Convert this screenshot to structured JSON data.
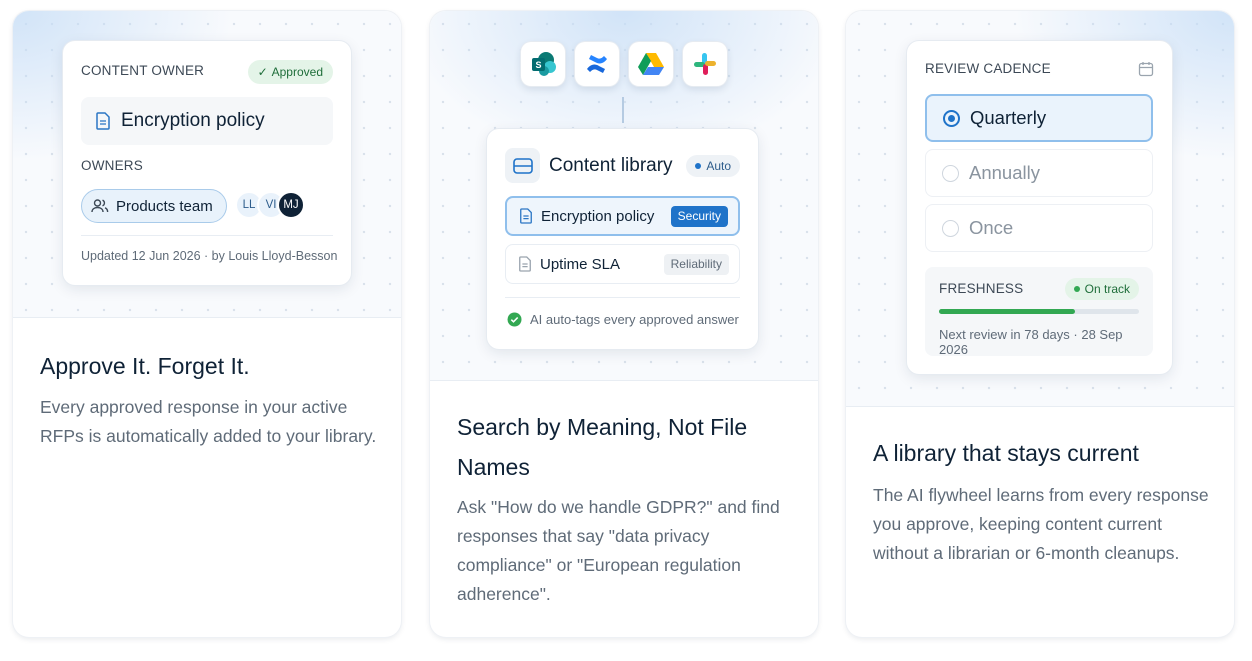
{
  "cards": [
    {
      "heading": "Approve It. Forget It.",
      "description": "Every approved response in your active RFPs is automatically added to your library.",
      "panel": {
        "label": "CONTENT OWNER",
        "status": "Approved",
        "document": "Encryption policy",
        "owners_label": "OWNERS",
        "team": "Products team",
        "avatars": [
          "LL",
          "VI",
          "MJ"
        ],
        "updated": "Updated 12 Jun 2026 · by Louis Lloyd-Besson"
      }
    },
    {
      "heading": "Search by Meaning, Not File Names",
      "description": "Ask \"How do we handle GDPR?\" and find responses that say \"data privacy compliance\" or \"European regulation adherence\".",
      "integrations": [
        "sharepoint-icon",
        "confluence-icon",
        "google-drive-icon",
        "slack-icon"
      ],
      "panel": {
        "title": "Content library",
        "mode": "Auto",
        "items": [
          {
            "name": "Encryption policy",
            "tag": "Security"
          },
          {
            "name": "Uptime SLA",
            "tag": "Reliability"
          }
        ],
        "footer": "AI auto-tags every approved answer"
      }
    },
    {
      "heading": "A library that stays current",
      "description": "The AI flywheel learns from every response you approve, keeping content current without a librarian or 6-month cleanups.",
      "panel": {
        "label": "REVIEW CADENCE",
        "options": [
          "Quarterly",
          "Annually",
          "Once"
        ],
        "selected": "Quarterly",
        "freshness_label": "FRESHNESS",
        "freshness_status": "On track",
        "freshness_progress": 0.68,
        "next_review": "Next review in 78 days · 28 Sep 2026"
      }
    }
  ],
  "colors": {
    "accent": "#1f73c9",
    "success": "#32a852",
    "heading": "#0f2236",
    "body": "#5f6b78"
  }
}
